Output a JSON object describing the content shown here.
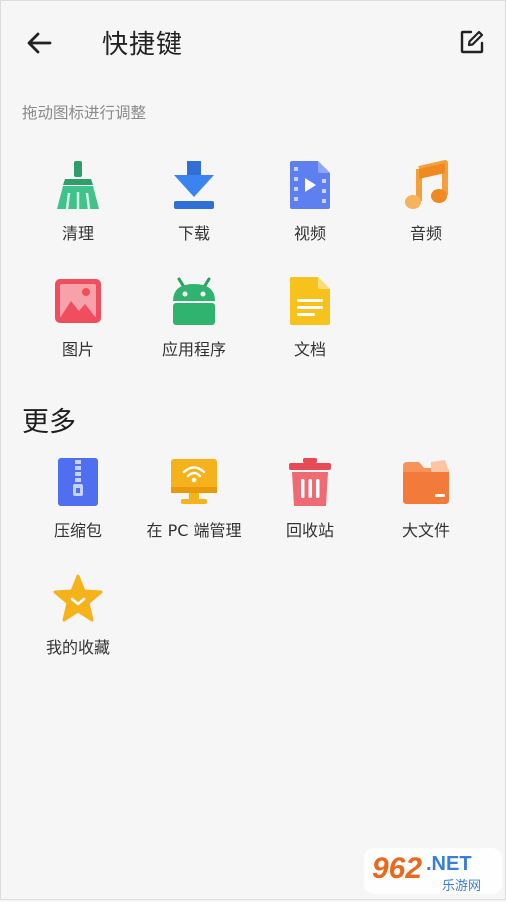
{
  "header": {
    "title": "快捷键",
    "back_icon": "arrow-left-icon",
    "edit_icon": "edit-icon"
  },
  "hint": "拖动图标进行调整",
  "shortcuts": [
    {
      "label": "清理",
      "icon": "broom-icon"
    },
    {
      "label": "下载",
      "icon": "download-icon"
    },
    {
      "label": "视频",
      "icon": "video-file-icon"
    },
    {
      "label": "音频",
      "icon": "music-note-icon"
    },
    {
      "label": "图片",
      "icon": "image-icon"
    },
    {
      "label": "应用程序",
      "icon": "android-icon"
    },
    {
      "label": "文档",
      "icon": "document-icon"
    }
  ],
  "more": {
    "title": "更多",
    "items": [
      {
        "label": "压缩包",
        "icon": "zip-icon"
      },
      {
        "label": "在 PC 端管理",
        "icon": "pc-wifi-icon"
      },
      {
        "label": "回收站",
        "icon": "trash-icon"
      },
      {
        "label": "大文件",
        "icon": "folder-icon"
      },
      {
        "label": "我的收藏",
        "icon": "star-icon"
      }
    ]
  },
  "watermark": {
    "brand": "962",
    "tld": ".NET",
    "sub": "乐游网"
  }
}
